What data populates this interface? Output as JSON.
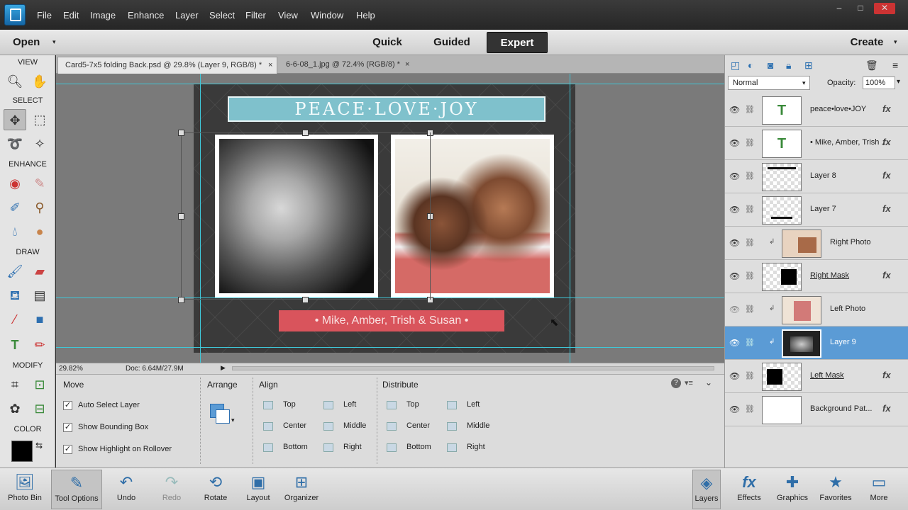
{
  "menu": [
    "File",
    "Edit",
    "Image",
    "Enhance",
    "Layer",
    "Select",
    "Filter",
    "View",
    "Window",
    "Help"
  ],
  "window_controls": [
    "–",
    "□",
    "✕"
  ],
  "modes": {
    "open": "Open",
    "quick": "Quick",
    "guided": "Guided",
    "expert": "Expert",
    "create": "Create"
  },
  "toolbox": {
    "view": "VIEW",
    "select": "SELECT",
    "enhance": "ENHANCE",
    "draw": "DRAW",
    "modify": "MODIFY",
    "color": "COLOR"
  },
  "tabs": [
    {
      "label": "Card5-7x5 folding Back.psd @ 29.8% (Layer 9, RGB/8) *",
      "close": "×"
    },
    {
      "label": "6-6-08_1.jpg @ 72.4% (RGB/8) *",
      "close": "×"
    }
  ],
  "canvas": {
    "banner": "PEACE·LOVE·JOY",
    "names": "• Mike, Amber, Trish & Susan •"
  },
  "status": {
    "zoom": "29.82%",
    "doc": "Doc: 6.64M/27.9M"
  },
  "options": {
    "move": "Move",
    "checkboxes": [
      "Auto Select Layer",
      "Show Bounding Box",
      "Show Highlight on Rollover"
    ],
    "arrange": "Arrange",
    "align": "Align",
    "align_items": [
      "Top",
      "Center",
      "Bottom",
      "Left",
      "Middle",
      "Right"
    ],
    "distribute": "Distribute",
    "distribute_items": [
      "Top",
      "Center",
      "Bottom",
      "Left",
      "Middle",
      "Right"
    ]
  },
  "layers_panel": {
    "blend_mode": "Normal",
    "opacity_label": "Opacity:",
    "opacity_value": "100%",
    "layers": [
      {
        "name": "peace•love•JOY",
        "fx": "fx"
      },
      {
        "name": "• Mike, Amber, Trish ...",
        "fx": "fx"
      },
      {
        "name": "Layer 8",
        "fx": "fx"
      },
      {
        "name": "Layer 7",
        "fx": "fx"
      },
      {
        "name": "Right Photo",
        "fx": ""
      },
      {
        "name": "Right Mask",
        "fx": "fx"
      },
      {
        "name": "Left Photo",
        "fx": ""
      },
      {
        "name": "Layer 9",
        "fx": ""
      },
      {
        "name": "Left Mask",
        "fx": "fx"
      },
      {
        "name": "Background Pat...",
        "fx": "fx"
      }
    ]
  },
  "bottom_left": [
    "Photo Bin",
    "Tool Options",
    "Undo",
    "Redo",
    "Rotate",
    "Layout",
    "Organizer"
  ],
  "bottom_right": [
    "Layers",
    "Effects",
    "Graphics",
    "Favorites",
    "More"
  ],
  "colors": {
    "accent": "#5b9bd5",
    "banner": "#7fc1cc",
    "namebar": "#d9545c",
    "guide": "#3fc7d8"
  }
}
